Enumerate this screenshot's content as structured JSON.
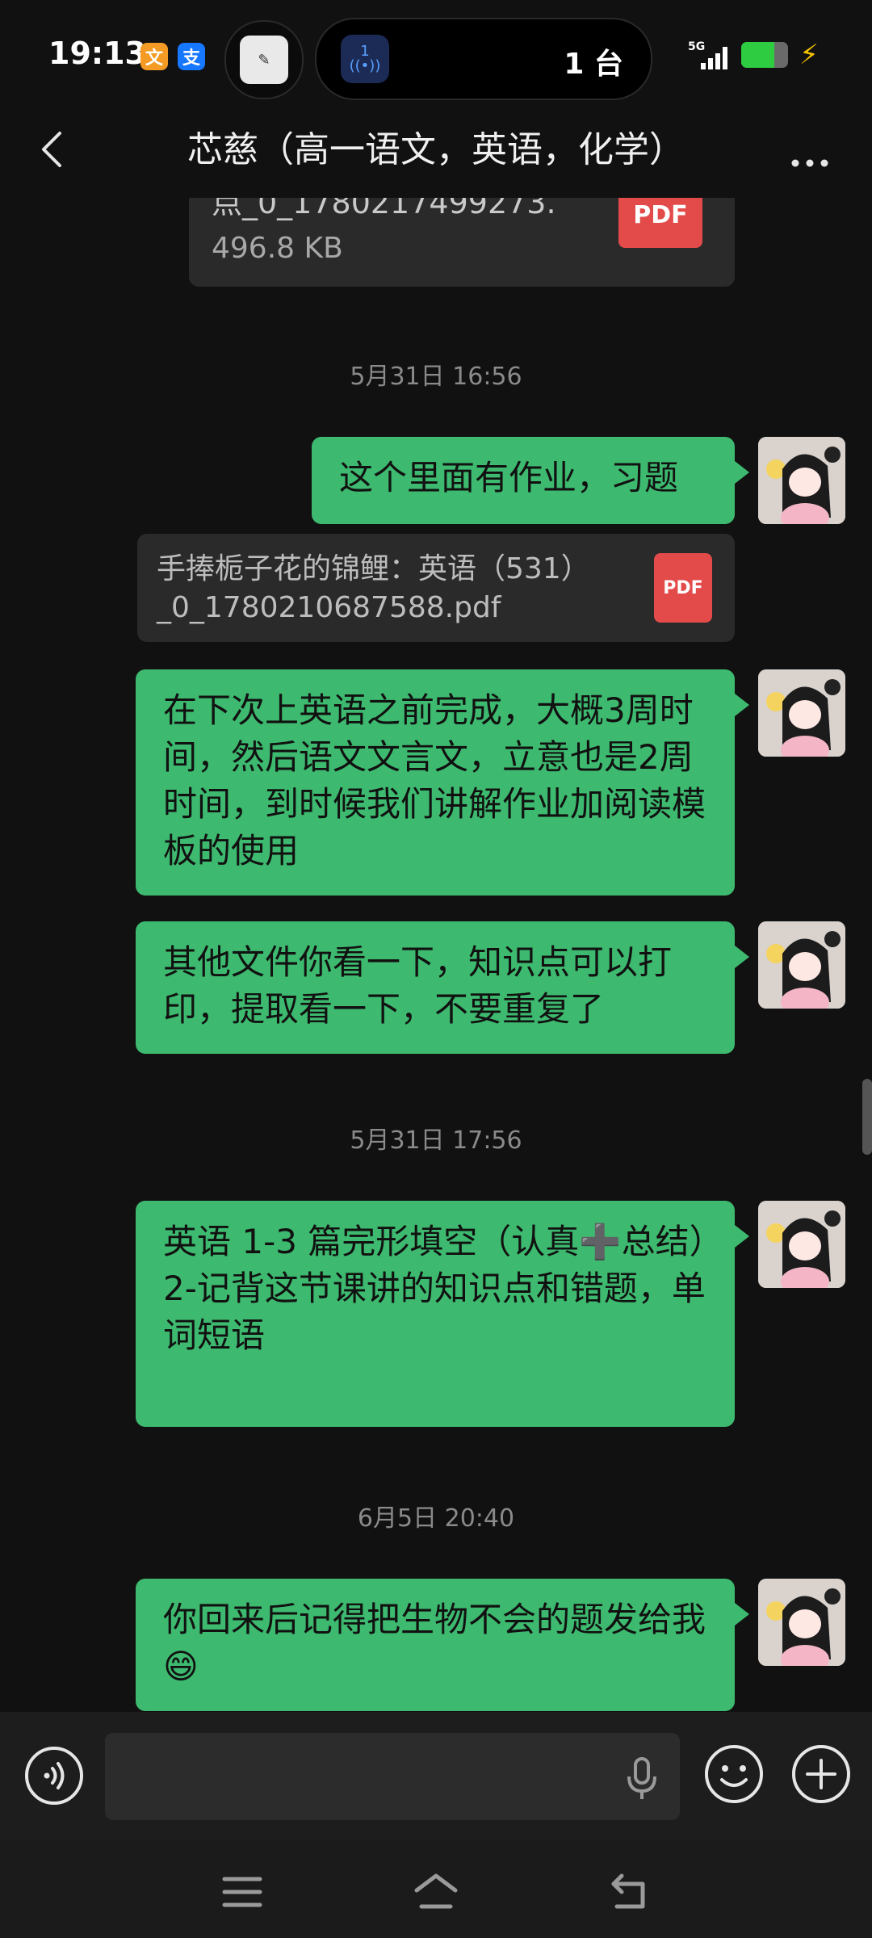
{
  "status_bar": {
    "time": "19:13",
    "app_badge_1": "文",
    "app_badge_2": "支",
    "island_icon_top": "1",
    "island_count": "1 台",
    "network": "5G",
    "battery_level": 0.7
  },
  "header": {
    "title": "芯慈（高一语文，英语，化学）"
  },
  "messages": {
    "partial_file": {
      "name": "点_0_1780217499273.",
      "size": "496.8 KB",
      "icon": "PDF"
    },
    "ts1": "5月31日 16:56",
    "msg1": "这个里面有作业，习题",
    "file2": {
      "line1": "手捧栀子花的锦鲤：英语（531）",
      "line2": "_0_1780210687588.pdf",
      "icon": "PDF"
    },
    "msg2": "在下次上英语之前完成，大概3周时间，然后语文文言文，立意也是2周时间，到时候我们讲解作业加阅读模板的使用",
    "msg3": "其他文件你看一下，知识点可以打印，提取看一下，不要重复了",
    "ts2": "5月31日 17:56",
    "msg4_line1": "英语 1-3 篇完形填空（认真➕总结）",
    "msg4_line2": "2-记背这节课讲的知识点和错题，单词短语",
    "ts3": "6月5日 20:40",
    "msg5": "你回来后记得把生物不会的题发给我😄"
  },
  "input": {
    "placeholder": ""
  },
  "colors": {
    "bubble": "#3dba6f",
    "background": "#111111",
    "pdf": "#e34a4a"
  }
}
